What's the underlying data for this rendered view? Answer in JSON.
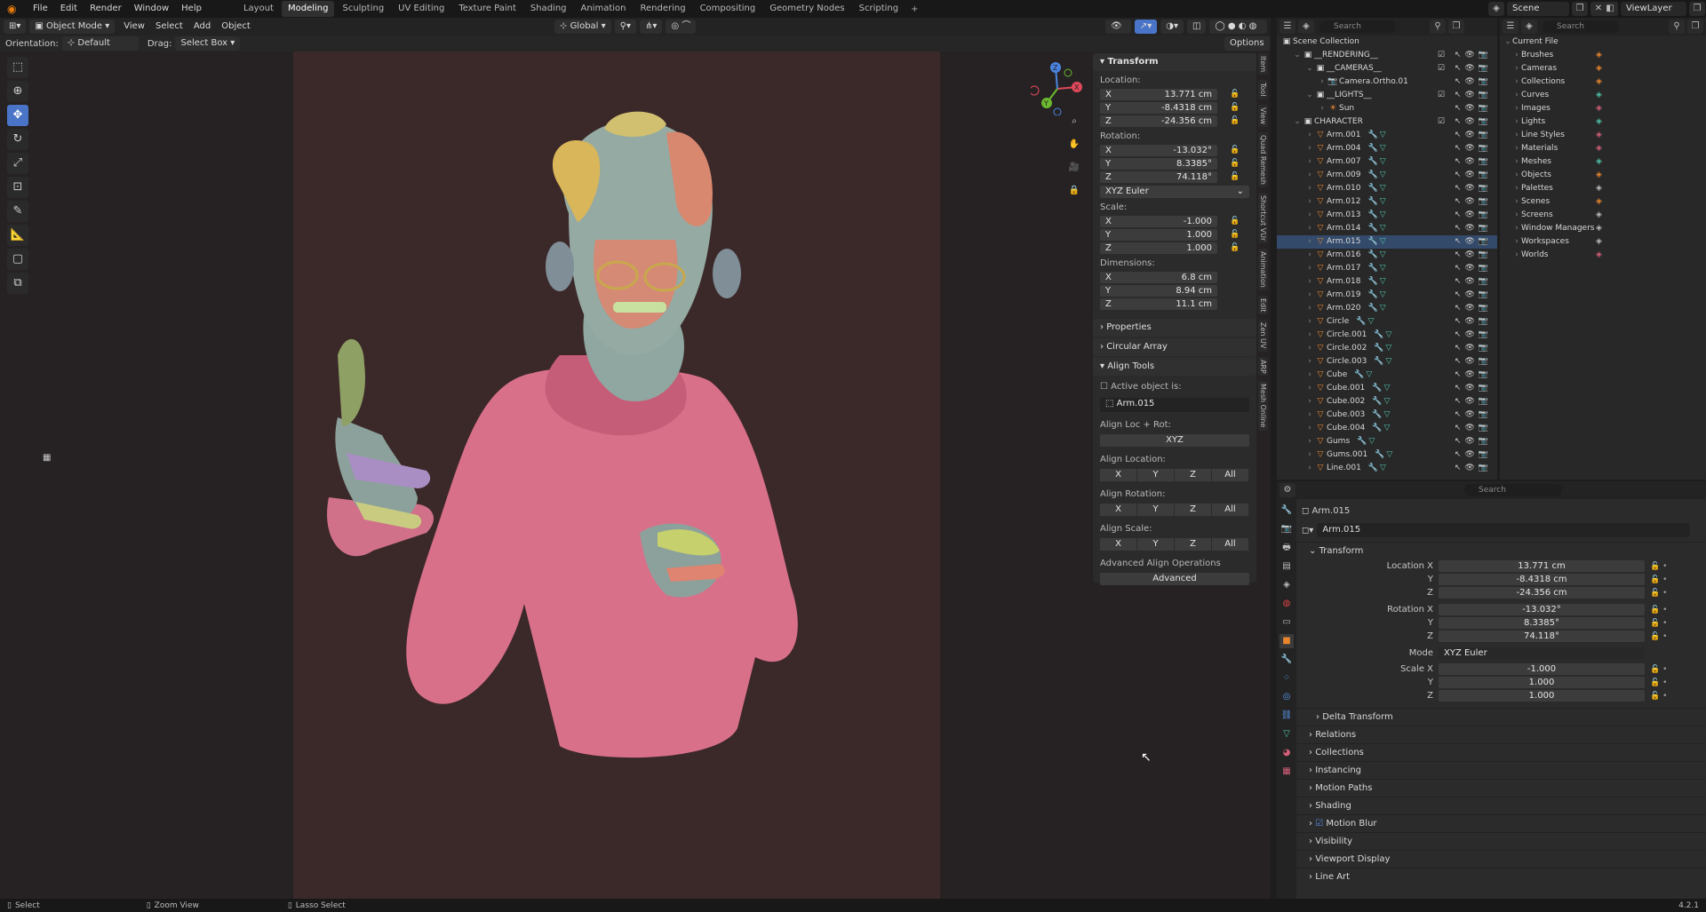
{
  "topbar": {
    "menus": [
      "File",
      "Edit",
      "Render",
      "Window",
      "Help"
    ],
    "workspaces": [
      "Layout",
      "Modeling",
      "Sculpting",
      "UV Editing",
      "Texture Paint",
      "Shading",
      "Animation",
      "Rendering",
      "Compositing",
      "Geometry Nodes",
      "Scripting"
    ],
    "active_workspace": "Modeling",
    "scene": "Scene",
    "view_layer": "ViewLayer"
  },
  "viewport_header": {
    "mode": "Object Mode",
    "menus": [
      "View",
      "Select",
      "Add",
      "Object"
    ],
    "transform_orientation": "Global",
    "options": "Options"
  },
  "tool_header": {
    "orientation_label": "Orientation:",
    "orientation_value": "Default",
    "drag_label": "Drag:",
    "drag_value": "Select Box"
  },
  "npanel": {
    "transform_title": "Transform",
    "location_label": "Location:",
    "location": [
      {
        "axis": "X",
        "value": "13.771 cm"
      },
      {
        "axis": "Y",
        "value": "-8.4318 cm"
      },
      {
        "axis": "Z",
        "value": "-24.356 cm"
      }
    ],
    "rotation_label": "Rotation:",
    "rotation": [
      {
        "axis": "X",
        "value": "-13.032°"
      },
      {
        "axis": "Y",
        "value": "8.3385°"
      },
      {
        "axis": "Z",
        "value": "74.118°"
      }
    ],
    "rotation_mode": "XYZ Euler",
    "scale_label": "Scale:",
    "scale": [
      {
        "axis": "X",
        "value": "-1.000"
      },
      {
        "axis": "Y",
        "value": "1.000"
      },
      {
        "axis": "Z",
        "value": "1.000"
      }
    ],
    "dimensions_label": "Dimensions:",
    "dimensions": [
      {
        "axis": "X",
        "value": "6.8 cm"
      },
      {
        "axis": "Y",
        "value": "8.94 cm"
      },
      {
        "axis": "Z",
        "value": "11.1 cm"
      }
    ],
    "properties_title": "Properties",
    "circular_array_title": "Circular Array",
    "align_tools_title": "Align Tools",
    "active_object_label": "Active object is:",
    "active_object": "Arm.015",
    "align_loc_rot_label": "Align Loc + Rot:",
    "align_loc_rot_btn": "XYZ",
    "align_location_label": "Align Location:",
    "align_rotation_label": "Align Rotation:",
    "align_scale_label": "Align Scale:",
    "axis_buttons": [
      "X",
      "Y",
      "Z",
      "All"
    ],
    "advanced_label": "Advanced Align Operations",
    "advanced_btn": "Advanced",
    "tabs": [
      "Item",
      "Tool",
      "View",
      "Quad Remesh",
      "Shortcut VUr",
      "Animation",
      "Edit",
      "Zen UV",
      "ARP",
      "Mesh Online"
    ]
  },
  "outliner": {
    "search_placeholder": "Search",
    "root": "Scene Collection",
    "items": [
      {
        "indent": 1,
        "name": "__RENDERING__",
        "icon": "▣"
      },
      {
        "indent": 2,
        "name": "__CAMERAS__",
        "icon": "▣"
      },
      {
        "indent": 3,
        "name": "Camera.Ortho.01",
        "icon": "📷"
      },
      {
        "indent": 2,
        "name": "__LIGHTS__",
        "icon": "▣"
      },
      {
        "indent": 3,
        "name": "Sun",
        "icon": "☀"
      },
      {
        "indent": 1,
        "name": "CHARACTER",
        "icon": "▣"
      },
      {
        "indent": 2,
        "name": "Arm.001",
        "icon": "▽"
      },
      {
        "indent": 2,
        "name": "Arm.004",
        "icon": "▽"
      },
      {
        "indent": 2,
        "name": "Arm.007",
        "icon": "▽"
      },
      {
        "indent": 2,
        "name": "Arm.009",
        "icon": "▽"
      },
      {
        "indent": 2,
        "name": "Arm.010",
        "icon": "▽"
      },
      {
        "indent": 2,
        "name": "Arm.012",
        "icon": "▽"
      },
      {
        "indent": 2,
        "name": "Arm.013",
        "icon": "▽"
      },
      {
        "indent": 2,
        "name": "Arm.014",
        "icon": "▽"
      },
      {
        "indent": 2,
        "name": "Arm.015",
        "icon": "▽"
      },
      {
        "indent": 2,
        "name": "Arm.016",
        "icon": "▽"
      },
      {
        "indent": 2,
        "name": "Arm.017",
        "icon": "▽"
      },
      {
        "indent": 2,
        "name": "Arm.018",
        "icon": "▽"
      },
      {
        "indent": 2,
        "name": "Arm.019",
        "icon": "▽"
      },
      {
        "indent": 2,
        "name": "Arm.020",
        "icon": "▽"
      },
      {
        "indent": 2,
        "name": "Circle",
        "icon": "▽"
      },
      {
        "indent": 2,
        "name": "Circle.001",
        "icon": "▽"
      },
      {
        "indent": 2,
        "name": "Circle.002",
        "icon": "▽"
      },
      {
        "indent": 2,
        "name": "Circle.003",
        "icon": "▽"
      },
      {
        "indent": 2,
        "name": "Cube",
        "icon": "▽"
      },
      {
        "indent": 2,
        "name": "Cube.001",
        "icon": "▽"
      },
      {
        "indent": 2,
        "name": "Cube.002",
        "icon": "▽"
      },
      {
        "indent": 2,
        "name": "Cube.003",
        "icon": "▽"
      },
      {
        "indent": 2,
        "name": "Cube.004",
        "icon": "▽"
      },
      {
        "indent": 2,
        "name": "Gums",
        "icon": "▽"
      },
      {
        "indent": 2,
        "name": "Gums.001",
        "icon": "▽"
      },
      {
        "indent": 2,
        "name": "Line.001",
        "icon": "▽"
      }
    ]
  },
  "file_browser": {
    "search_placeholder": "Search",
    "root": "Current File",
    "items": [
      "Brushes",
      "Cameras",
      "Collections",
      "Curves",
      "Images",
      "Lights",
      "Line Styles",
      "Materials",
      "Meshes",
      "Objects",
      "Palettes",
      "Scenes",
      "Screens",
      "Window Managers",
      "Workspaces",
      "Worlds"
    ]
  },
  "properties": {
    "search_placeholder": "Search",
    "object_name": "Arm.015",
    "datablock": "Arm.015",
    "transform_title": "Transform",
    "rows": [
      {
        "label": "Location X",
        "value": "13.771 cm"
      },
      {
        "label": "Y",
        "value": "-8.4318 cm"
      },
      {
        "label": "Z",
        "value": "-24.356 cm"
      },
      {
        "label": "Rotation X",
        "value": "-13.032°"
      },
      {
        "label": "Y",
        "value": "8.3385°"
      },
      {
        "label": "Z",
        "value": "74.118°"
      }
    ],
    "mode_label": "Mode",
    "mode_value": "XYZ Euler",
    "scale_rows": [
      {
        "label": "Scale X",
        "value": "-1.000"
      },
      {
        "label": "Y",
        "value": "1.000"
      },
      {
        "label": "Z",
        "value": "1.000"
      }
    ],
    "delta_transform": "Delta Transform",
    "sections": [
      "Relations",
      "Collections",
      "Instancing",
      "Motion Paths",
      "Shading",
      "Motion Blur",
      "Visibility",
      "Viewport Display",
      "Line Art"
    ]
  },
  "statusbar": {
    "select": "Select",
    "zoom": "Zoom View",
    "lasso": "Lasso Select",
    "version": "4.2.1"
  }
}
